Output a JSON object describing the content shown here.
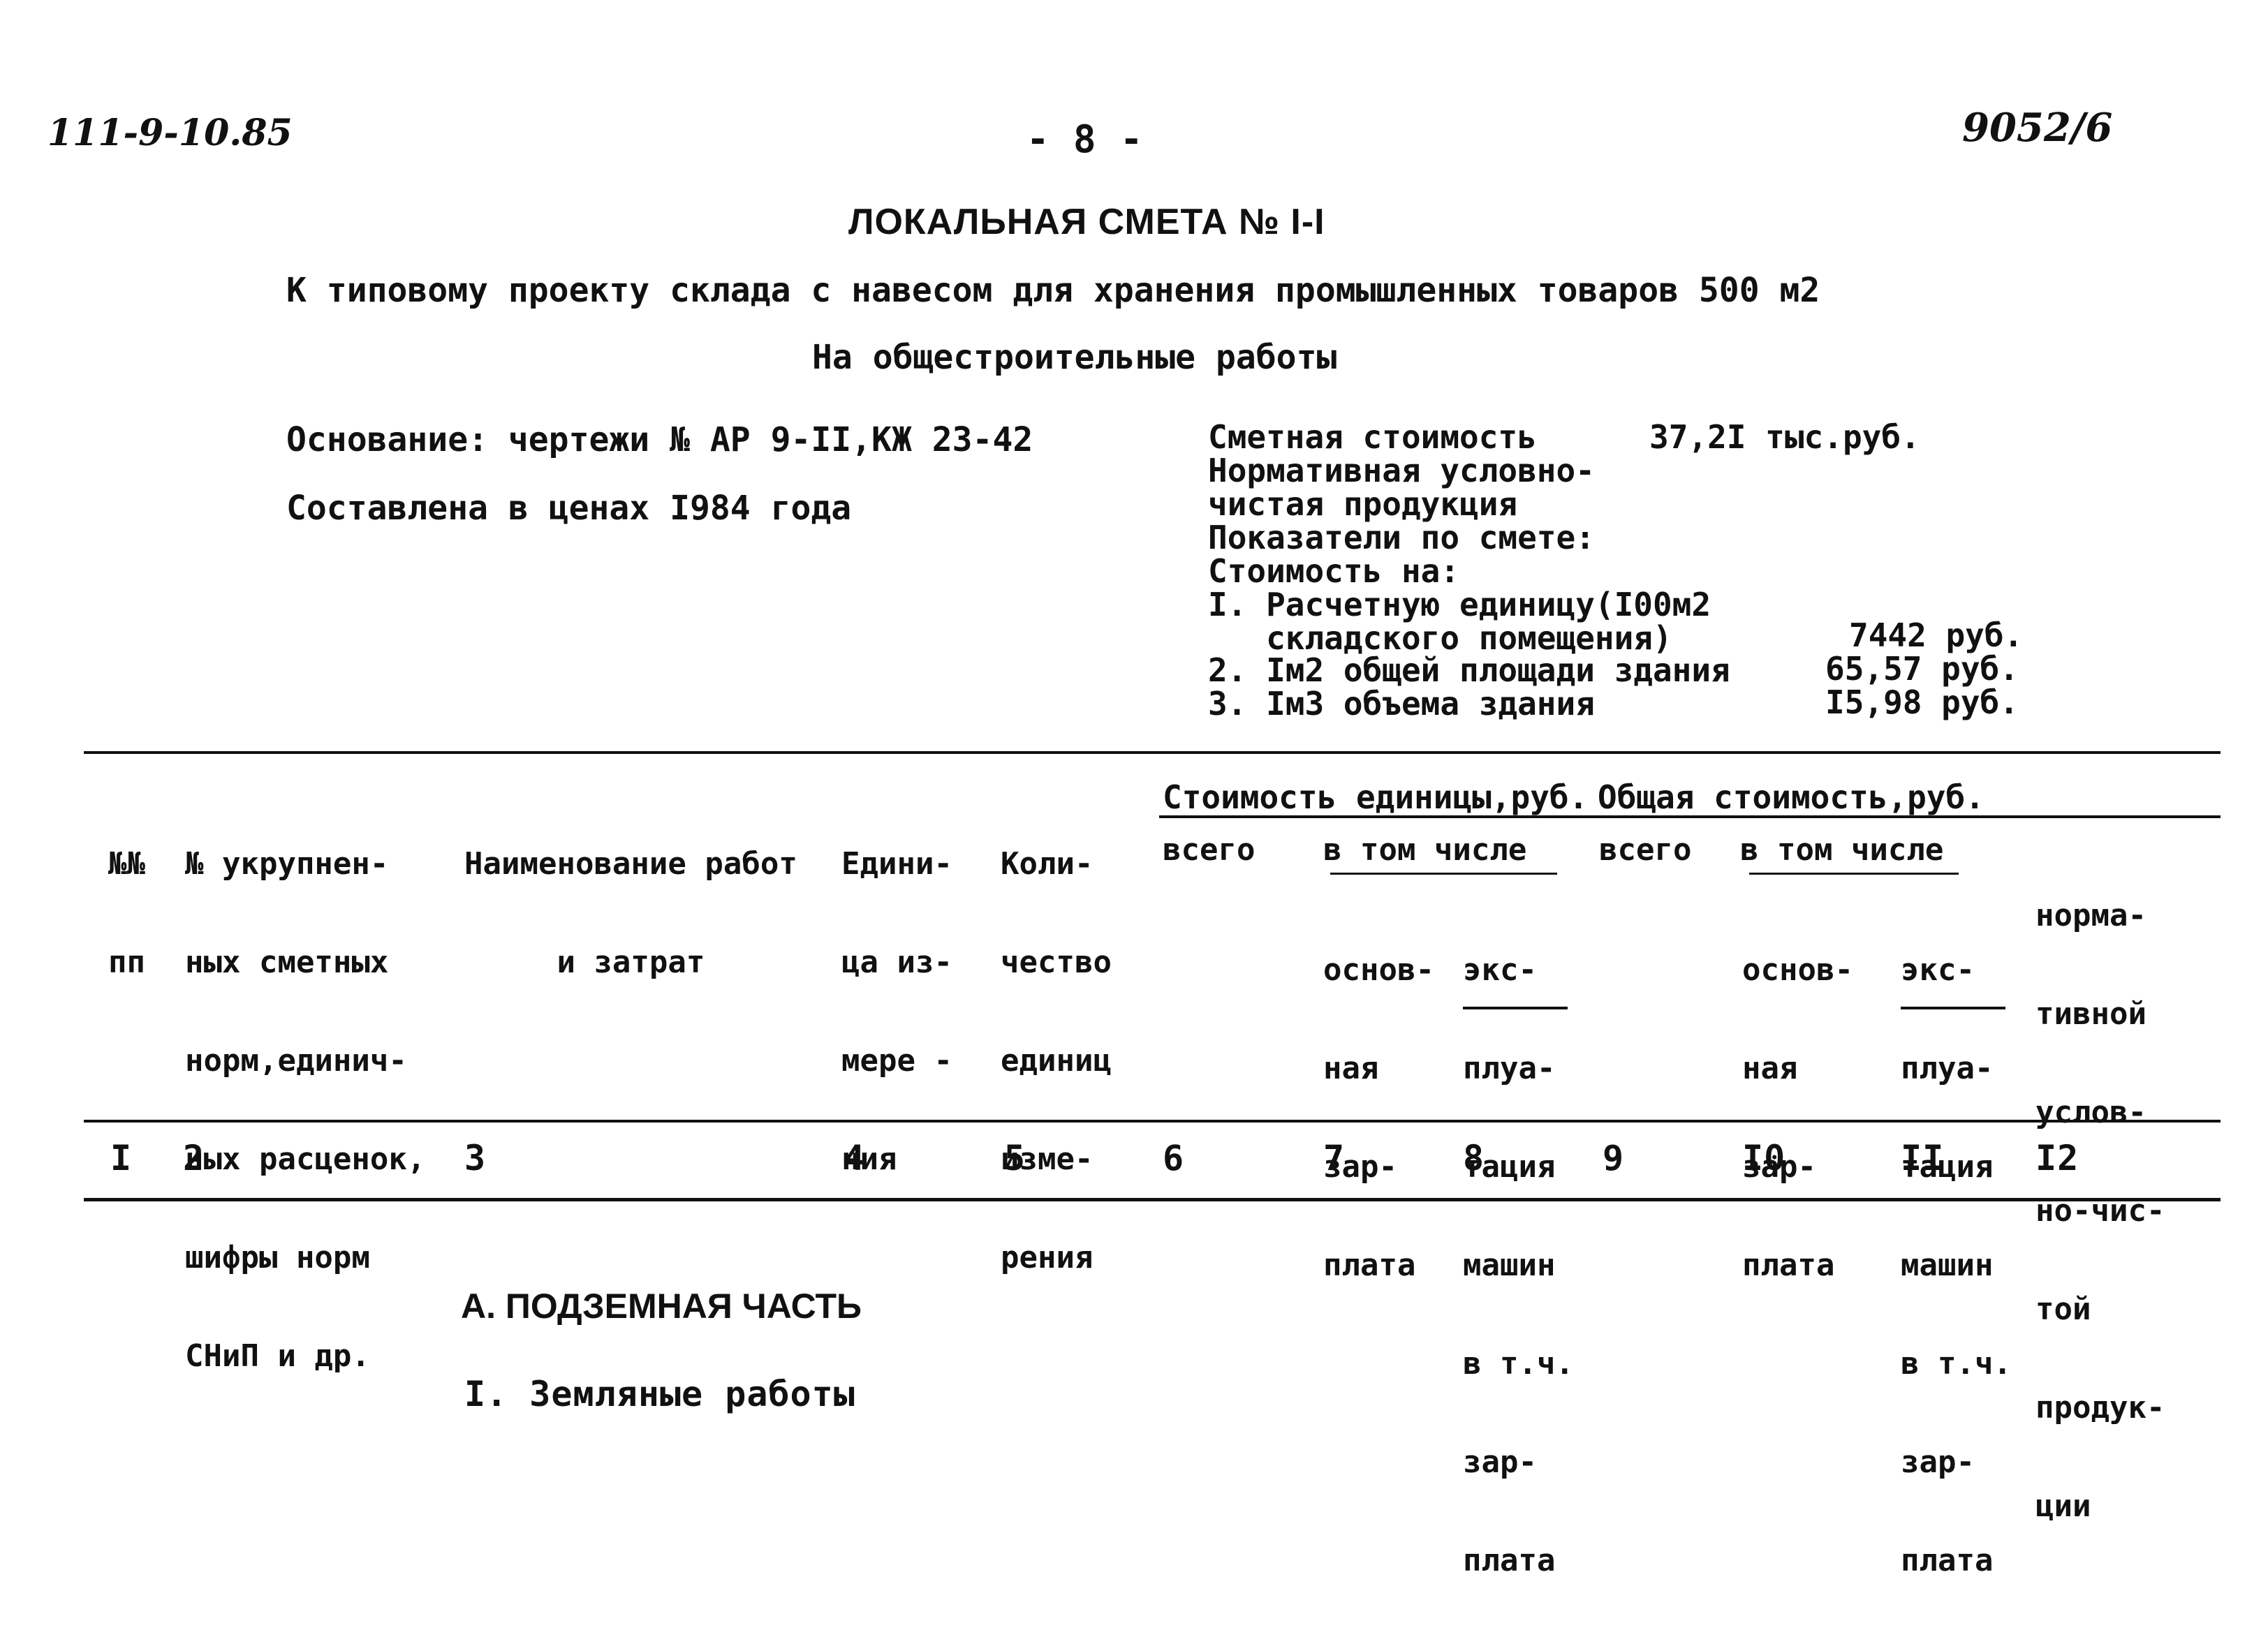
{
  "header": {
    "left_code": "111-9-10.85",
    "page_number": "- 8 -",
    "right_code": "9052/6"
  },
  "title": {
    "main": "ЛОКАЛЬНАЯ СМЕТА № I-I",
    "subtitle": "К типовому проекту склада с навесом для хранения промышленных товаров 500 м2",
    "scope": "На общестроительные работы"
  },
  "basis": {
    "line1": "Основание: чертежи № АР 9-II,КЖ 23-42",
    "line2": "Составлена в ценах I984 года"
  },
  "summary": {
    "estimated_cost_label": "Сметная стоимость",
    "estimated_cost_value": "37,2I тыс.руб.",
    "normative_label_1": "Нормативная условно-",
    "normative_label_2": "чистая продукция",
    "indicators_label": "Показатели по смете:",
    "cost_per_label": "Стоимость на:",
    "items": [
      {
        "label_1": "I. Расчетную единицу(I00м2",
        "label_2": "   складского помещения)",
        "value": "7442 руб."
      },
      {
        "label_1": "2. Iм2 общей площади здания",
        "value": "65,57 руб."
      },
      {
        "label_1": "3. Iм3 объема здания",
        "value": "I5,98 руб."
      }
    ]
  },
  "table": {
    "headers": {
      "col1": [
        "№№",
        "пп"
      ],
      "col2": [
        "№ укрупнен-",
        "ных сметных",
        "норм,единич-",
        "ных расценок,",
        "шифры норм",
        "СНиП и др."
      ],
      "col3": [
        "Наименование работ",
        "и затрат"
      ],
      "col4": [
        "Едини-",
        "ца из-",
        "мере -",
        "ния"
      ],
      "col5": [
        "Коли-",
        "чество",
        "единиц",
        "изме-",
        "рения"
      ],
      "group_unit_cost": "Стоимость единицы,руб.",
      "group_total_cost": "Общая стоимость,руб.",
      "total": "всего",
      "including": "в том числе",
      "base_salary": [
        "основ-",
        "ная",
        "зар-",
        "плата"
      ],
      "machine_operation": [
        "экс-",
        "плуа-",
        "тация",
        "машин"
      ],
      "machine_salary": [
        "в т.ч.",
        "зар-",
        "плата"
      ],
      "normative": [
        "норма-",
        "тивной",
        "услов-",
        "но-чис-",
        "той",
        "продук-",
        "ции"
      ]
    },
    "column_numbers": [
      "I",
      "2",
      "3",
      "4",
      "5",
      "6",
      "7",
      "8",
      "9",
      "I0",
      "II",
      "I2"
    ]
  },
  "sections": {
    "part": "А. ПОДЗЕМНАЯ ЧАСТЬ",
    "subsection": "I. Земляные работы"
  }
}
